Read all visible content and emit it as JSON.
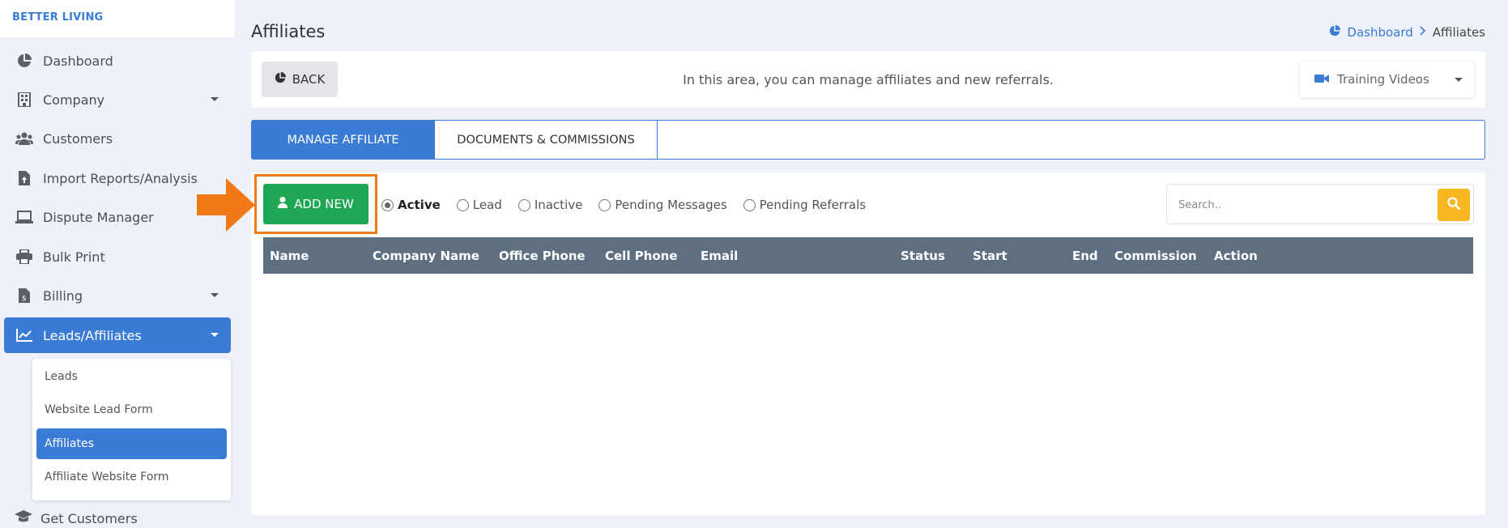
{
  "brand": "BETTER LIVING",
  "sidebar": {
    "items": [
      {
        "label": "Dashboard",
        "icon": "pie-chart-icon"
      },
      {
        "label": "Company",
        "icon": "building-icon"
      },
      {
        "label": "Customers",
        "icon": "users-icon"
      },
      {
        "label": "Import Reports/Analysis",
        "icon": "file-upload-icon"
      },
      {
        "label": "Dispute Manager",
        "icon": "laptop-icon"
      },
      {
        "label": "Bulk Print",
        "icon": "printer-icon"
      },
      {
        "label": "Billing",
        "icon": "invoice-icon"
      },
      {
        "label": "Leads/Affiliates",
        "icon": "chart-line-icon"
      }
    ],
    "submenu": [
      "Leads",
      "Website Lead Form",
      "Affiliates",
      "Affiliate Website Form"
    ],
    "bottom_item": "Get Customers"
  },
  "header": {
    "title": "Affiliates",
    "breadcrumb": {
      "link": "Dashboard",
      "current": "Affiliates"
    }
  },
  "info": {
    "back_label": "BACK",
    "text": "In this area, you can manage affiliates and new referrals.",
    "training_label": "Training Videos"
  },
  "tabs": [
    {
      "label": "MANAGE AFFILIATE",
      "active": true
    },
    {
      "label": "DOCUMENTS & COMMISSIONS",
      "active": false
    }
  ],
  "toolbar": {
    "add_label": "ADD NEW",
    "filters": [
      "Active",
      "Lead",
      "Inactive",
      "Pending Messages",
      "Pending Referrals"
    ],
    "selected_filter": "Active",
    "search_placeholder": "Search.."
  },
  "table": {
    "columns": [
      "Name",
      "Company Name",
      "Office Phone",
      "Cell Phone",
      "Email",
      "Status",
      "Start",
      "End",
      "Commission",
      "Action"
    ]
  },
  "colors": {
    "accent": "#3a7bd5",
    "add_button": "#1fa756",
    "search_button": "#f8b620",
    "highlight": "#f07a17",
    "table_header": "#5e6f82"
  }
}
